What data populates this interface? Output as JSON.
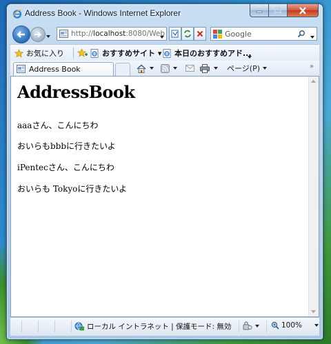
{
  "window": {
    "title": "Address Book - Windows Internet Explorer"
  },
  "address_bar": {
    "url_prefix": "http://",
    "url_host": "localhost",
    "url_rest": ":8080/Web"
  },
  "search": {
    "placeholder": "Google"
  },
  "favorites_bar": {
    "favorites_label": "お気に入り",
    "items": [
      {
        "label": "おすすめサイト ▾"
      },
      {
        "label": "本日のおすすめアド..."
      }
    ]
  },
  "tab": {
    "label": "Address Book"
  },
  "command_bar": {
    "page_label": "ページ(P)"
  },
  "page": {
    "heading": "AddressBook",
    "lines": [
      "aaaさん、こんにちわ",
      "おいらもbbbに行きたいよ",
      "iPentecさん、こんにちわ",
      "おいらも Tokyoに行きたいよ"
    ]
  },
  "status_bar": {
    "zone_text": "ローカル イントラネット | 保護モード: 無効",
    "zoom": "100%"
  },
  "colors": {
    "title_text": "#0b1a2c",
    "close_button": "#c23a1f",
    "link_blue": "#1d4f8c"
  }
}
